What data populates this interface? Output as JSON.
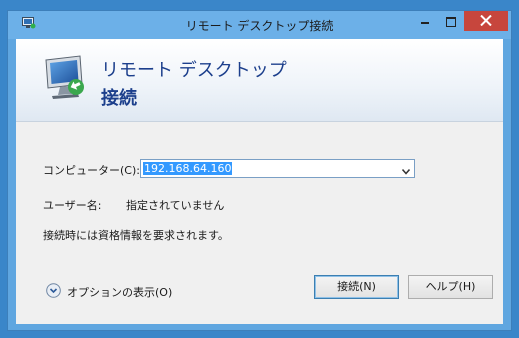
{
  "window": {
    "title": "リモート デスクトップ接続"
  },
  "banner": {
    "line1": "リモート デスクトップ",
    "line2": "接続"
  },
  "form": {
    "computer_label": "コンピューター(C):",
    "computer_value": "192.168.64.160",
    "user_label": "ユーザー名:",
    "user_value": "指定されていません",
    "note": "接続時には資格情報を要求されます。"
  },
  "footer": {
    "options_label": "オプションの表示(O)",
    "connect_label": "接続(N)",
    "help_label": "ヘルプ(H)"
  },
  "colors": {
    "titlebar": "#6cb0e8",
    "close_button": "#c7463d",
    "banner_text": "#1c3f8c",
    "selection": "#3399ff"
  },
  "icons": {
    "app": "remote-desktop-icon",
    "banner": "remote-desktop-monitor-icon",
    "options": "chevron-down-circle-icon",
    "combo": "dropdown-arrow-icon"
  }
}
